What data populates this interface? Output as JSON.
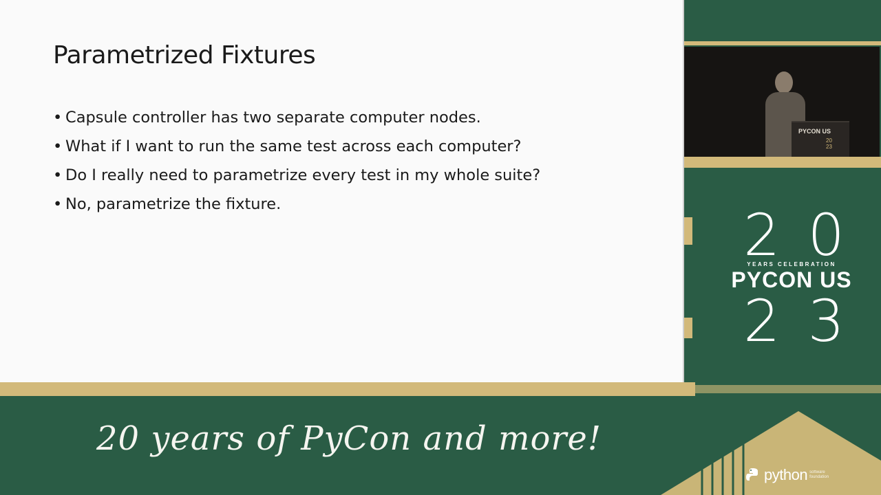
{
  "slide": {
    "title": "Parametrized Fixtures",
    "bullets": [
      "Capsule controller has two separate computer nodes.",
      "What if I want to run the same test across each computer?",
      "Do I really need to parametrize every test in my whole suite?",
      "No, parametrize the fixture."
    ]
  },
  "video": {
    "podium_logo": "PYCON US",
    "podium_year_top": "20",
    "podium_year_bottom": "23"
  },
  "brand": {
    "top_number": "20",
    "subtitle": "YEARS CELEBRATION",
    "name": "PYCON US",
    "bottom_number": "23"
  },
  "footer": {
    "tagline": "20 years of PyCon and more!",
    "python_word": "python",
    "python_small": "software foundation"
  },
  "colors": {
    "background_green": "#2a5c45",
    "accent_gold": "#d2b97a",
    "slide_bg": "#fafafa"
  }
}
